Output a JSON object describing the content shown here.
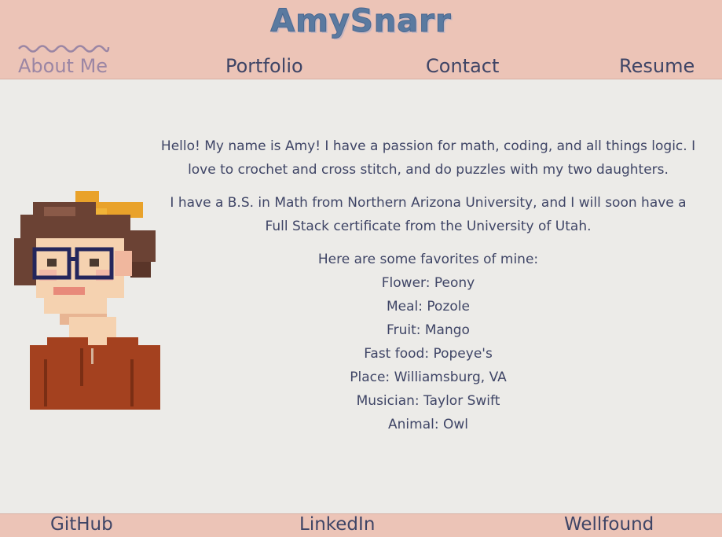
{
  "header": {
    "site_title": "AmySnarr",
    "nav": [
      {
        "label": "About Me",
        "active": true
      },
      {
        "label": "Portfolio",
        "active": false
      },
      {
        "label": "Contact",
        "active": false
      },
      {
        "label": "Resume",
        "active": false
      }
    ]
  },
  "main": {
    "intro": "Hello! My name is Amy! I have a passion for math, coding, and all things logic. I love to crochet and cross stitch, and do puzzles with my two daughters.",
    "education": "I have a B.S. in Math from Northern Arizona University, and I will soon have a Full Stack certificate from the University of Utah.",
    "favorites_heading": "Here are some favorites of mine:",
    "favorites": [
      "Flower: Peony",
      "Meal: Pozole",
      "Fruit: Mango",
      "Fast food: Popeye's",
      "Place: Williamsburg, VA",
      "Musician: Taylor Swift",
      "Animal: Owl"
    ]
  },
  "footer": {
    "links": [
      {
        "label": "GitHub"
      },
      {
        "label": "LinkedIn"
      },
      {
        "label": "Wellfound"
      }
    ]
  },
  "colors": {
    "header_bg": "#ecc4b7",
    "page_bg": "#ecebe8",
    "text": "#3f4566",
    "active_nav": "#9b86a4",
    "title": "#5a7aa0"
  }
}
